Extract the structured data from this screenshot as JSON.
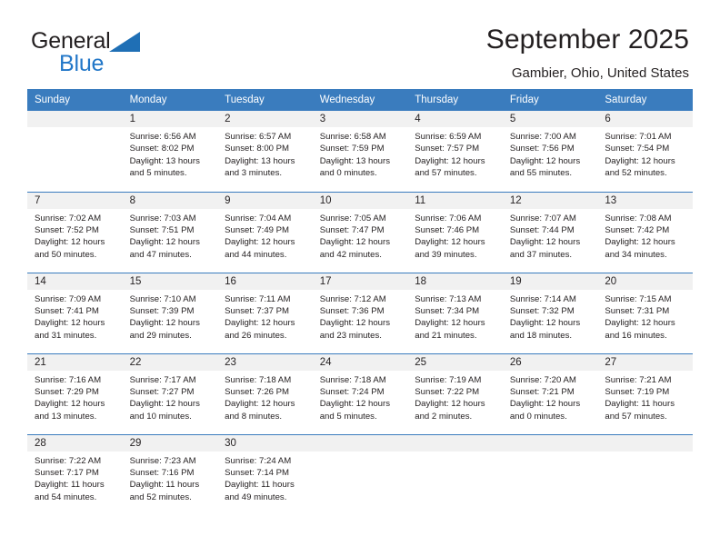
{
  "brand": {
    "line1": "General",
    "line2": "Blue",
    "triangle_color": "#1f6fb5",
    "name": "General Blue"
  },
  "header": {
    "title": "September 2025",
    "subtitle": "Gambier, Ohio, United States"
  },
  "colors": {
    "header_blue": "#3a7cbe",
    "brand_blue": "#2277c8",
    "daynum_band": "#f1f1f1",
    "text": "#231f20"
  },
  "weekday_headers": [
    "Sunday",
    "Monday",
    "Tuesday",
    "Wednesday",
    "Thursday",
    "Friday",
    "Saturday"
  ],
  "labels": {
    "sunrise": "Sunrise:",
    "sunset": "Sunset:",
    "daylight": "Daylight:"
  },
  "weeks": [
    [
      {
        "day": "",
        "lines": []
      },
      {
        "day": "1",
        "lines": [
          "Sunrise: 6:56 AM",
          "Sunset: 8:02 PM",
          "Daylight: 13 hours",
          "and 5 minutes."
        ]
      },
      {
        "day": "2",
        "lines": [
          "Sunrise: 6:57 AM",
          "Sunset: 8:00 PM",
          "Daylight: 13 hours",
          "and 3 minutes."
        ]
      },
      {
        "day": "3",
        "lines": [
          "Sunrise: 6:58 AM",
          "Sunset: 7:59 PM",
          "Daylight: 13 hours",
          "and 0 minutes."
        ]
      },
      {
        "day": "4",
        "lines": [
          "Sunrise: 6:59 AM",
          "Sunset: 7:57 PM",
          "Daylight: 12 hours",
          "and 57 minutes."
        ]
      },
      {
        "day": "5",
        "lines": [
          "Sunrise: 7:00 AM",
          "Sunset: 7:56 PM",
          "Daylight: 12 hours",
          "and 55 minutes."
        ]
      },
      {
        "day": "6",
        "lines": [
          "Sunrise: 7:01 AM",
          "Sunset: 7:54 PM",
          "Daylight: 12 hours",
          "and 52 minutes."
        ]
      }
    ],
    [
      {
        "day": "7",
        "lines": [
          "Sunrise: 7:02 AM",
          "Sunset: 7:52 PM",
          "Daylight: 12 hours",
          "and 50 minutes."
        ]
      },
      {
        "day": "8",
        "lines": [
          "Sunrise: 7:03 AM",
          "Sunset: 7:51 PM",
          "Daylight: 12 hours",
          "and 47 minutes."
        ]
      },
      {
        "day": "9",
        "lines": [
          "Sunrise: 7:04 AM",
          "Sunset: 7:49 PM",
          "Daylight: 12 hours",
          "and 44 minutes."
        ]
      },
      {
        "day": "10",
        "lines": [
          "Sunrise: 7:05 AM",
          "Sunset: 7:47 PM",
          "Daylight: 12 hours",
          "and 42 minutes."
        ]
      },
      {
        "day": "11",
        "lines": [
          "Sunrise: 7:06 AM",
          "Sunset: 7:46 PM",
          "Daylight: 12 hours",
          "and 39 minutes."
        ]
      },
      {
        "day": "12",
        "lines": [
          "Sunrise: 7:07 AM",
          "Sunset: 7:44 PM",
          "Daylight: 12 hours",
          "and 37 minutes."
        ]
      },
      {
        "day": "13",
        "lines": [
          "Sunrise: 7:08 AM",
          "Sunset: 7:42 PM",
          "Daylight: 12 hours",
          "and 34 minutes."
        ]
      }
    ],
    [
      {
        "day": "14",
        "lines": [
          "Sunrise: 7:09 AM",
          "Sunset: 7:41 PM",
          "Daylight: 12 hours",
          "and 31 minutes."
        ]
      },
      {
        "day": "15",
        "lines": [
          "Sunrise: 7:10 AM",
          "Sunset: 7:39 PM",
          "Daylight: 12 hours",
          "and 29 minutes."
        ]
      },
      {
        "day": "16",
        "lines": [
          "Sunrise: 7:11 AM",
          "Sunset: 7:37 PM",
          "Daylight: 12 hours",
          "and 26 minutes."
        ]
      },
      {
        "day": "17",
        "lines": [
          "Sunrise: 7:12 AM",
          "Sunset: 7:36 PM",
          "Daylight: 12 hours",
          "and 23 minutes."
        ]
      },
      {
        "day": "18",
        "lines": [
          "Sunrise: 7:13 AM",
          "Sunset: 7:34 PM",
          "Daylight: 12 hours",
          "and 21 minutes."
        ]
      },
      {
        "day": "19",
        "lines": [
          "Sunrise: 7:14 AM",
          "Sunset: 7:32 PM",
          "Daylight: 12 hours",
          "and 18 minutes."
        ]
      },
      {
        "day": "20",
        "lines": [
          "Sunrise: 7:15 AM",
          "Sunset: 7:31 PM",
          "Daylight: 12 hours",
          "and 16 minutes."
        ]
      }
    ],
    [
      {
        "day": "21",
        "lines": [
          "Sunrise: 7:16 AM",
          "Sunset: 7:29 PM",
          "Daylight: 12 hours",
          "and 13 minutes."
        ]
      },
      {
        "day": "22",
        "lines": [
          "Sunrise: 7:17 AM",
          "Sunset: 7:27 PM",
          "Daylight: 12 hours",
          "and 10 minutes."
        ]
      },
      {
        "day": "23",
        "lines": [
          "Sunrise: 7:18 AM",
          "Sunset: 7:26 PM",
          "Daylight: 12 hours",
          "and 8 minutes."
        ]
      },
      {
        "day": "24",
        "lines": [
          "Sunrise: 7:18 AM",
          "Sunset: 7:24 PM",
          "Daylight: 12 hours",
          "and 5 minutes."
        ]
      },
      {
        "day": "25",
        "lines": [
          "Sunrise: 7:19 AM",
          "Sunset: 7:22 PM",
          "Daylight: 12 hours",
          "and 2 minutes."
        ]
      },
      {
        "day": "26",
        "lines": [
          "Sunrise: 7:20 AM",
          "Sunset: 7:21 PM",
          "Daylight: 12 hours",
          "and 0 minutes."
        ]
      },
      {
        "day": "27",
        "lines": [
          "Sunrise: 7:21 AM",
          "Sunset: 7:19 PM",
          "Daylight: 11 hours",
          "and 57 minutes."
        ]
      }
    ],
    [
      {
        "day": "28",
        "lines": [
          "Sunrise: 7:22 AM",
          "Sunset: 7:17 PM",
          "Daylight: 11 hours",
          "and 54 minutes."
        ]
      },
      {
        "day": "29",
        "lines": [
          "Sunrise: 7:23 AM",
          "Sunset: 7:16 PM",
          "Daylight: 11 hours",
          "and 52 minutes."
        ]
      },
      {
        "day": "30",
        "lines": [
          "Sunrise: 7:24 AM",
          "Sunset: 7:14 PM",
          "Daylight: 11 hours",
          "and 49 minutes."
        ]
      },
      {
        "day": "",
        "lines": []
      },
      {
        "day": "",
        "lines": []
      },
      {
        "day": "",
        "lines": []
      },
      {
        "day": "",
        "lines": []
      }
    ]
  ]
}
